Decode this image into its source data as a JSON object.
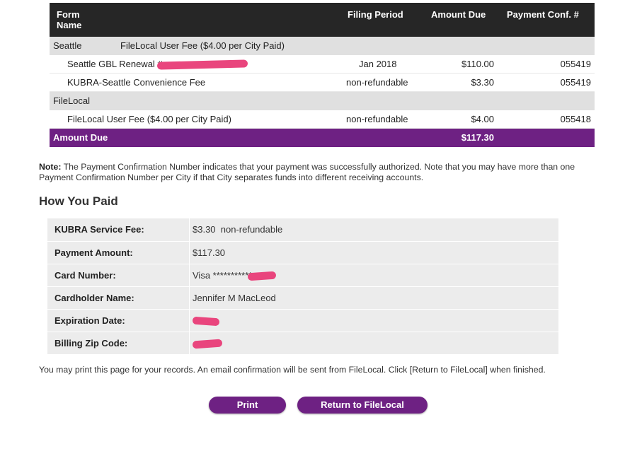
{
  "fees_table": {
    "headers": {
      "form_name": "Form Name",
      "filing_period": "Filing Period",
      "amount_due": "Amount Due",
      "payment_conf": "Payment Conf. #"
    },
    "groups": [
      {
        "name": "Seattle",
        "description": "FileLocal User Fee ($4.00 per City Paid)",
        "rows": [
          {
            "description": "Seattle GBL Renewal #",
            "period": "Jan 2018",
            "amount": "$110.00",
            "conf": "055419"
          },
          {
            "description": "KUBRA-Seattle Convenience Fee",
            "period": "non-refundable",
            "amount": "$3.30",
            "conf": "055419"
          }
        ]
      },
      {
        "name": "FileLocal",
        "rows": [
          {
            "description": "FileLocal User Fee ($4.00 per City Paid)",
            "period": "non-refundable",
            "amount": "$4.00",
            "conf": "055418"
          }
        ]
      }
    ],
    "total": {
      "label": "Amount Due",
      "value": "$117.30"
    }
  },
  "note": {
    "prefix": "Note:",
    "text": " The Payment Confirmation Number indicates that your payment was successfully authorized. Note that you may have more than one Payment Confirmation Number per City if that City separates funds into different receiving accounts."
  },
  "how_you_paid": {
    "title": "How You Paid",
    "rows": [
      {
        "label": "KUBRA Service Fee:",
        "value": "$3.30  non-refundable"
      },
      {
        "label": "Payment Amount:",
        "value": "$117.30"
      },
      {
        "label": "Card Number:",
        "value": "Visa ***********"
      },
      {
        "label": "Cardholder Name:",
        "value": "Jennifer M MacLeod"
      },
      {
        "label": "Expiration Date:",
        "value": ""
      },
      {
        "label": "Billing Zip Code:",
        "value": ""
      }
    ]
  },
  "footer": {
    "text": "You may print this page for your records. An email confirmation will be sent from FileLocal. Click [Return to FileLocal] when finished."
  },
  "buttons": {
    "print": "Print",
    "return": "Return to FileLocal"
  },
  "colors": {
    "header_bg": "#262626",
    "group_bg": "#e0e0e0",
    "brand_purple": "#6e2183",
    "redaction": "#e9457d"
  }
}
